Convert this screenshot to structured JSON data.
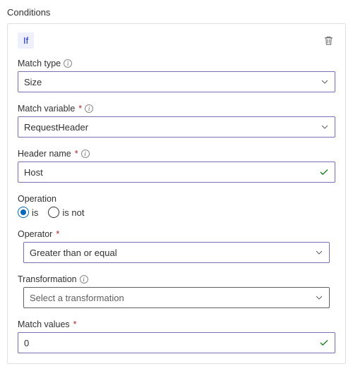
{
  "sectionTitle": "Conditions",
  "ifBadge": "If",
  "fields": {
    "matchType": {
      "label": "Match type",
      "value": "Size"
    },
    "matchVariable": {
      "label": "Match variable",
      "value": "RequestHeader"
    },
    "headerName": {
      "label": "Header name",
      "value": "Host"
    },
    "operation": {
      "label": "Operation",
      "isLabel": "is",
      "isNotLabel": "is not",
      "selected": "is"
    },
    "operator": {
      "label": "Operator",
      "value": "Greater than or equal"
    },
    "transformation": {
      "label": "Transformation",
      "placeholder": "Select a transformation"
    },
    "matchValues": {
      "label": "Match values",
      "value": "0"
    }
  }
}
